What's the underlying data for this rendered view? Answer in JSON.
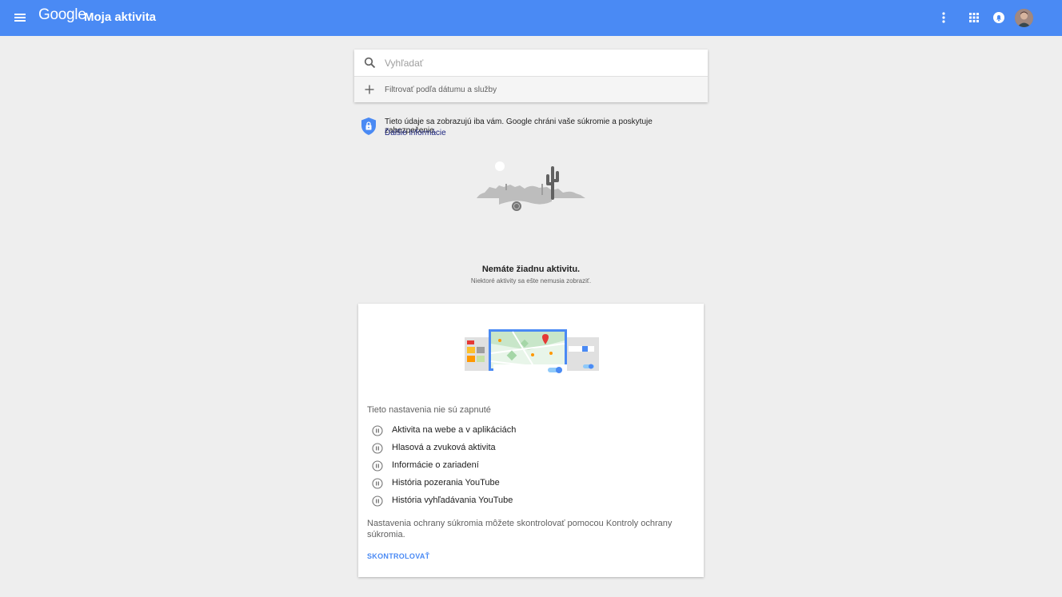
{
  "appbar": {
    "logo": "Google",
    "title": "Moja aktivita",
    "color": "#4a8af4",
    "icons": [
      "menu-icon",
      "more-vert-icon",
      "apps-grid-icon",
      "notifications-icon"
    ]
  },
  "search": {
    "placeholder": "Vyhľadať",
    "filter_label": "Filtrovať podľa dátumu a služby"
  },
  "privacy": {
    "text": "Tieto údaje sa zobrazujú iba vám. Google chráni vaše súkromie a poskytuje zabezpečenie.",
    "link": "Ďalšie informácie"
  },
  "empty_state": {
    "title": "Nemáte žiadnu aktivitu.",
    "subtitle": "Niektoré aktivity sa ešte nemusia zobraziť."
  },
  "settings": {
    "heading": "Tieto nastavenia nie sú zapnuté",
    "items": [
      {
        "label": "Aktivita na webe a v aplikáciách"
      },
      {
        "label": "Hlasová a zvuková aktivita"
      },
      {
        "label": "Informácie o zariadení"
      },
      {
        "label": "História pozerania YouTube"
      },
      {
        "label": "História vyhľadávania YouTube"
      }
    ],
    "description": "Nastavenia ochrany súkromia môžete skontrolovať pomocou Kontroly ochrany súkromia.",
    "button": "SKONTROLOVAŤ"
  }
}
